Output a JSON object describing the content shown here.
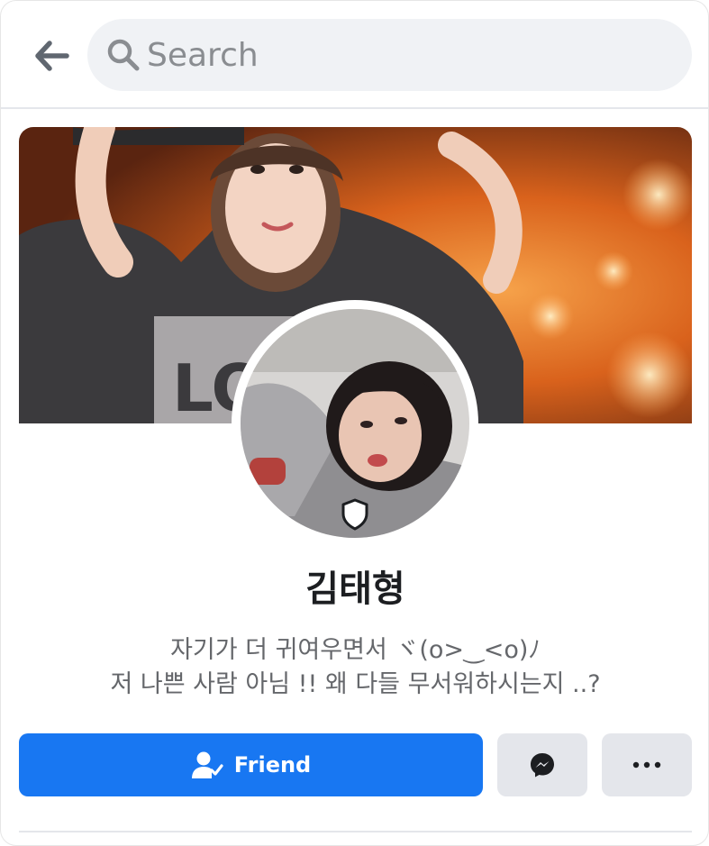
{
  "header": {
    "back_icon": "arrow-left-icon",
    "search_icon": "search-icon",
    "search_placeholder": "Search"
  },
  "profile": {
    "cover_image": "cover-photo",
    "avatar_image": "profile-photo",
    "badge_icon": "shield-icon",
    "name": "김태형",
    "bio_line_1": "자기가 더 귀여우면서 ヾ(o>‿<o)ﾉ",
    "bio_line_2": "저 나쁜 사람 아님 !! 왜 다들 무서워하시는지 ..?"
  },
  "actions": {
    "friend_label": "Friend",
    "friend_icon": "person-check-icon",
    "messenger_icon": "messenger-icon",
    "more_icon": "more-dots-icon"
  },
  "colors": {
    "accent": "#1877f2",
    "secondary_button": "#e4e6eb",
    "search_bg": "#f0f2f5",
    "text_primary": "#1c1e21",
    "text_secondary": "#65676b"
  }
}
